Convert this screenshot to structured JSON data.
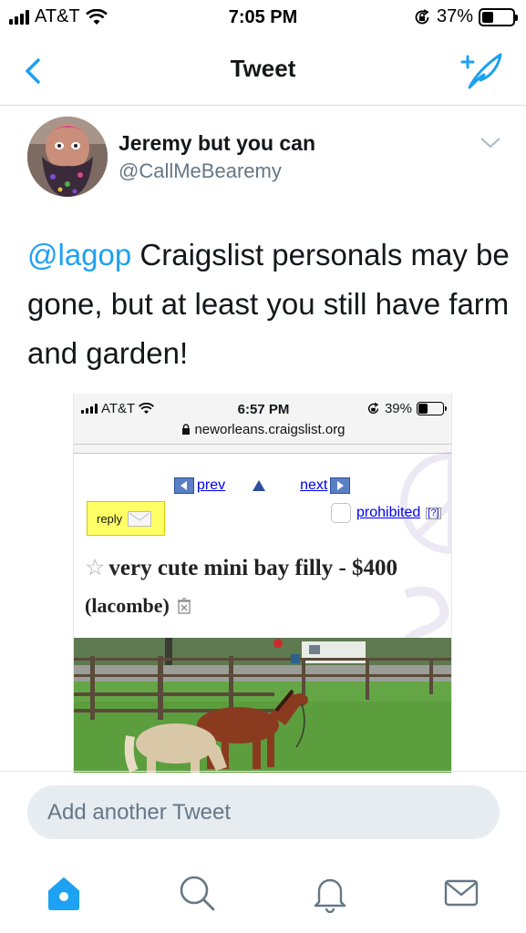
{
  "status_bar": {
    "carrier": "AT&T",
    "time": "7:05 PM",
    "battery": "37%",
    "battery_level": 0.37
  },
  "nav": {
    "title": "Tweet"
  },
  "tweet": {
    "author_name": "Jeremy but you can",
    "author_handle": "@CallMeBearemy",
    "mention": "@lagop",
    "text": " Craigslist personals may be gone, but at least you still have farm and garden!"
  },
  "embedded_screenshot": {
    "status_bar": {
      "carrier": "AT&T",
      "time": "6:57 PM",
      "battery": "39%",
      "battery_level": 0.39
    },
    "url": "neworleans.craigslist.org",
    "prev_label": "prev",
    "next_label": "next",
    "reply_label": "reply",
    "prohibited_label": "prohibited",
    "help_label": "[?]",
    "listing_title": "very cute mini bay filly - $400",
    "listing_location": "(lacombe)"
  },
  "reply_bar": {
    "placeholder": "Add another Tweet"
  },
  "tab_bar": {
    "items": [
      "home-icon",
      "search-icon",
      "notifications-icon",
      "messages-icon"
    ],
    "active": "home-icon"
  },
  "colors": {
    "accent": "#1da1f2",
    "text": "#14171a",
    "secondary_text": "#657786",
    "reply_bg": "#e6ecf0",
    "craigslist_reply_bg": "#ffff66",
    "craigslist_link": "#0000ee"
  }
}
